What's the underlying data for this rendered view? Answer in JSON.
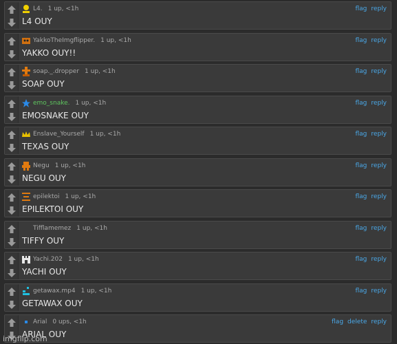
{
  "comments": [
    {
      "username": "L4.",
      "stats": "1 up, <1h",
      "text": "L4 OUY",
      "avatar": "yellow-person-icon",
      "actions": [
        "flag",
        "reply"
      ]
    },
    {
      "username": "YakkoTheImgflipper.",
      "stats": "1 up, <1h",
      "text": "YAKKO OUY!!",
      "avatar": "orange-crown-icon",
      "actions": [
        "flag",
        "reply"
      ]
    },
    {
      "username": "soap._.dropper",
      "stats": "1 up, <1h",
      "text": "SOAP OUY",
      "avatar": "orange-totem-icon",
      "actions": [
        "flag",
        "reply"
      ]
    },
    {
      "username": "emo_snake.",
      "stats": "1 up, <1h",
      "text": "EMOSNAKE OUY",
      "avatar": "blue-star-icon",
      "actions": [
        "flag",
        "reply"
      ]
    },
    {
      "username": "Enslave_Yourself",
      "stats": "1 up, <1h",
      "text": "TEXAS OUY",
      "avatar": "gold-crown-icon",
      "actions": [
        "flag",
        "reply"
      ]
    },
    {
      "username": "Negu",
      "stats": "1 up, <1h",
      "text": "NEGU OUY",
      "avatar": "orange-figure-icon",
      "actions": [
        "flag",
        "reply"
      ]
    },
    {
      "username": "epilektoi",
      "stats": "1 up, <1h",
      "text": "EPILEKTOI OUY",
      "avatar": "orange-stack-icon",
      "actions": [
        "flag",
        "reply"
      ]
    },
    {
      "username": "Tifflamemez",
      "stats": "1 up, <1h",
      "text": "TIFFY OUY",
      "avatar": "blank-avatar-icon",
      "actions": [
        "flag",
        "reply"
      ]
    },
    {
      "username": "Yachi.202",
      "stats": "1 up, <1h",
      "text": "YACHI OUY",
      "avatar": "white-castle-icon",
      "actions": [
        "flag",
        "reply"
      ]
    },
    {
      "username": "getawax.mp4",
      "stats": "1 up, <1h",
      "text": "GETAWAX OUY",
      "avatar": "cyan-pixel-icon",
      "actions": [
        "flag",
        "reply"
      ]
    },
    {
      "username": "Arial",
      "stats": "0 ups, <1h",
      "text": "ARIAL OUY",
      "avatar": "small-blue-dot-icon",
      "actions": [
        "flag",
        "delete",
        "reply"
      ]
    }
  ],
  "watermark": "imgflip.com",
  "colors": {
    "background": "#2b2b2b",
    "card": "#3a3a3a",
    "link": "#4aa8e8",
    "green_user": "#5fc65f"
  }
}
